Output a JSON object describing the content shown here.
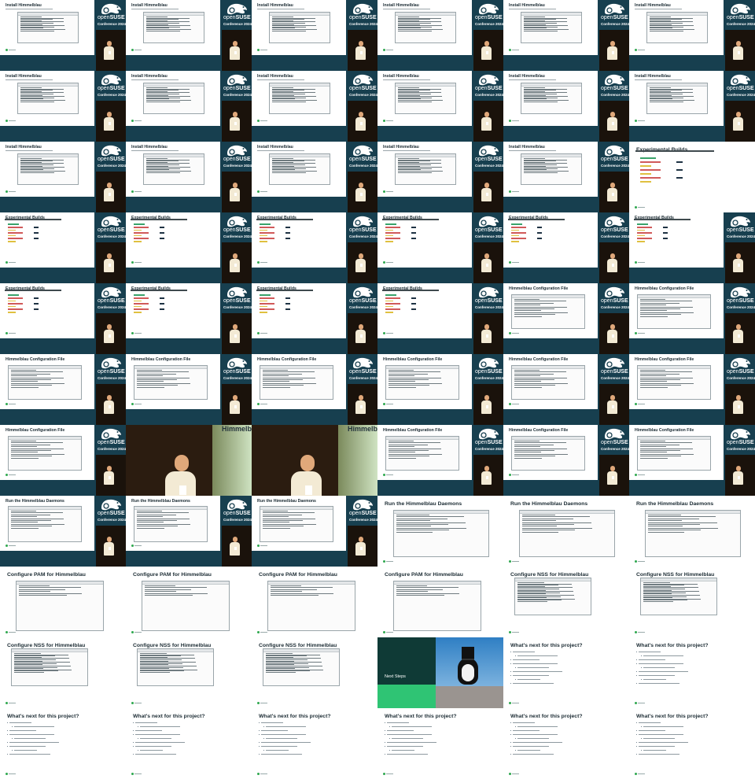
{
  "conference": {
    "brand_open": "open",
    "brand_suse": "SUSE",
    "name": "Conference 2024"
  },
  "titles": {
    "install": "Install Himmelblau",
    "experimental": "Experimental Builds",
    "config": "Himmelblau Configuration File",
    "daemons": "Run the Himmelblau Daemons",
    "pam": "Configure PAM for Himmelblau",
    "nss": "Configure NSS for Himmelblau",
    "next_steps": "Next Steps",
    "whats_next": "What's next for this project?"
  },
  "live_wall_text": "Himmelb",
  "tiles": [
    "install",
    "install",
    "install",
    "install",
    "install",
    "install",
    "install",
    "install",
    "install",
    "install",
    "install",
    "install",
    "install",
    "install",
    "install",
    "install",
    "install",
    "experimental-full",
    "experimental",
    "experimental",
    "experimental",
    "experimental",
    "experimental",
    "experimental",
    "experimental",
    "experimental",
    "experimental",
    "experimental",
    "config",
    "config",
    "config",
    "config",
    "config",
    "config",
    "config",
    "config",
    "config",
    "live",
    "live",
    "config",
    "config",
    "config",
    "daemons",
    "daemons",
    "daemons",
    "daemons-full",
    "daemons-full",
    "daemons-full",
    "pam-full",
    "pam-full",
    "pam-full",
    "pam-full",
    "nss-full",
    "nss-full",
    "nss-full",
    "nss-full",
    "nss-full",
    "next",
    "whats-full",
    "whats-full",
    "whats-full",
    "whats-full",
    "whats-full",
    "whats-full",
    "whats-full",
    "whats-full"
  ],
  "colors": {
    "bg_dark": "#173f4f",
    "accent_green": "#2fa84f"
  }
}
